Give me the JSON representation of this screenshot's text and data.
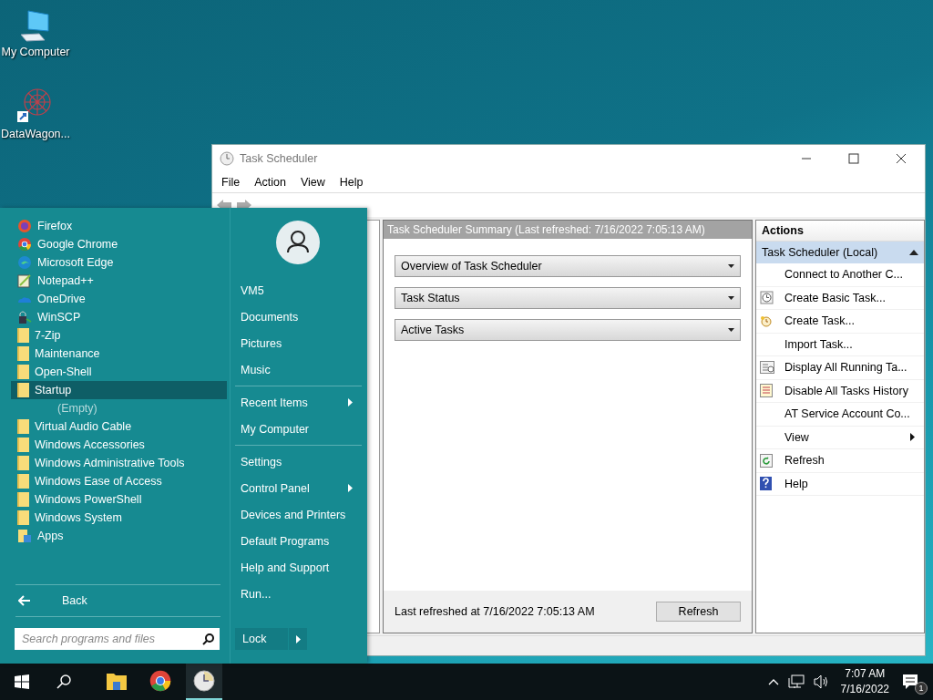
{
  "desktop_icons": [
    {
      "label": "My Computer",
      "kind": "computer"
    },
    {
      "label": "DataWagon...",
      "kind": "shortcut"
    }
  ],
  "window": {
    "title": "Task Scheduler",
    "menu": [
      "File",
      "Action",
      "View",
      "Help"
    ],
    "summary": {
      "header": "Task Scheduler Summary (Last refreshed: 7/16/2022 7:05:13 AM)",
      "sections": [
        {
          "label": "Overview of Task Scheduler",
          "expanded": false
        },
        {
          "label": "Task Status",
          "expanded": false
        },
        {
          "label": "Active Tasks",
          "expanded": false
        }
      ],
      "footer": "Last refreshed at 7/16/2022 7:05:13 AM",
      "button": "Refresh"
    },
    "actions": {
      "title": "Actions",
      "group": "Task Scheduler (Local)",
      "expanded": true,
      "items": [
        {
          "label": "Connect to Another C...",
          "kind": "plain"
        },
        {
          "label": "Create Basic Task...",
          "kind": "clock"
        },
        {
          "label": "Create Task...",
          "kind": "newtask"
        },
        {
          "label": "Import Task...",
          "kind": "plain"
        },
        {
          "label": "Display All Running Ta...",
          "kind": "running"
        },
        {
          "label": "Disable All Tasks History",
          "kind": "history"
        },
        {
          "label": "AT Service Account Co...",
          "kind": "plain"
        },
        {
          "label": "View",
          "kind": "submenu"
        },
        {
          "label": "Refresh",
          "kind": "refresh"
        },
        {
          "label": "Help",
          "kind": "help"
        }
      ]
    }
  },
  "start_menu": {
    "programs": [
      {
        "label": "Firefox",
        "kind": "firefox",
        "selected": false
      },
      {
        "label": "Google Chrome",
        "kind": "chrome",
        "selected": false
      },
      {
        "label": "Microsoft Edge",
        "kind": "edge",
        "selected": false
      },
      {
        "label": "Notepad++",
        "kind": "notepad",
        "selected": false
      },
      {
        "label": "OneDrive",
        "kind": "onedrive",
        "selected": false
      },
      {
        "label": "WinSCP",
        "kind": "winscp",
        "selected": false
      },
      {
        "label": "7-Zip",
        "kind": "folder",
        "selected": false
      },
      {
        "label": "Maintenance",
        "kind": "folder",
        "selected": false
      },
      {
        "label": "Open-Shell",
        "kind": "folder",
        "selected": false
      },
      {
        "label": "Startup",
        "kind": "folder",
        "selected": true
      },
      {
        "label": "(Empty)",
        "kind": "empty",
        "selected": false
      },
      {
        "label": "Virtual Audio Cable",
        "kind": "folder",
        "selected": false
      },
      {
        "label": "Windows Accessories",
        "kind": "folder",
        "selected": false
      },
      {
        "label": "Windows Administrative Tools",
        "kind": "folder",
        "selected": false
      },
      {
        "label": "Windows Ease of Access",
        "kind": "folder",
        "selected": false
      },
      {
        "label": "Windows PowerShell",
        "kind": "folder",
        "selected": false
      },
      {
        "label": "Windows System",
        "kind": "folder",
        "selected": false
      },
      {
        "label": "Apps",
        "kind": "apps",
        "selected": false
      }
    ],
    "back": "Back",
    "search": {
      "placeholder": "Search programs and files"
    },
    "places": [
      [
        {
          "label": "VM5",
          "submenu": false
        },
        {
          "label": "Documents",
          "submenu": false
        },
        {
          "label": "Pictures",
          "submenu": false
        },
        {
          "label": "Music",
          "submenu": false
        }
      ],
      [
        {
          "label": "Recent Items",
          "submenu": true
        },
        {
          "label": "My Computer",
          "submenu": false
        }
      ],
      [
        {
          "label": "Settings",
          "submenu": false
        },
        {
          "label": "Control Panel",
          "submenu": true
        },
        {
          "label": "Devices and Printers",
          "submenu": false
        },
        {
          "label": "Default Programs",
          "submenu": false
        },
        {
          "label": "Help and Support",
          "submenu": false
        },
        {
          "label": "Run...",
          "submenu": false
        }
      ]
    ],
    "lock": "Lock"
  },
  "taskbar": {
    "apps": [
      {
        "kind": "explorer",
        "selected": false
      },
      {
        "kind": "chrome",
        "selected": false
      },
      {
        "kind": "clock",
        "selected": true
      }
    ],
    "time": "7:07 AM",
    "date": "7/16/2022",
    "notifications": "1"
  }
}
